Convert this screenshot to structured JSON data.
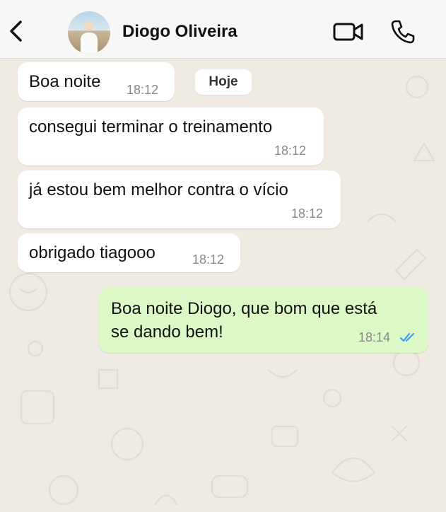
{
  "header": {
    "back_icon": "chevron-left-icon",
    "contact_name": "Diogo Oliveira",
    "video_icon": "video-camera-icon",
    "call_icon": "phone-icon"
  },
  "chat": {
    "date_chip": "Hoje",
    "messages": [
      {
        "direction": "incoming",
        "text": "Boa noite",
        "time": "18:12"
      },
      {
        "direction": "incoming",
        "text": "consegui terminar o treinamento",
        "time": "18:12"
      },
      {
        "direction": "incoming",
        "text": "já estou bem melhor contra o vício",
        "time": "18:12"
      },
      {
        "direction": "incoming",
        "text": "obrigado tiagooo",
        "time": "18:12"
      },
      {
        "direction": "outgoing",
        "text_line1": "Boa noite Diogo, que bom que está",
        "text_line2": "se dando bem!",
        "time": "18:14",
        "status_icon": "double-check-read-icon"
      }
    ]
  },
  "colors": {
    "incoming_bubble": "#ffffff",
    "outgoing_bubble": "#dcf8c6",
    "read_ticks": "#3c9bf5",
    "wallpaper": "#efeae2"
  }
}
